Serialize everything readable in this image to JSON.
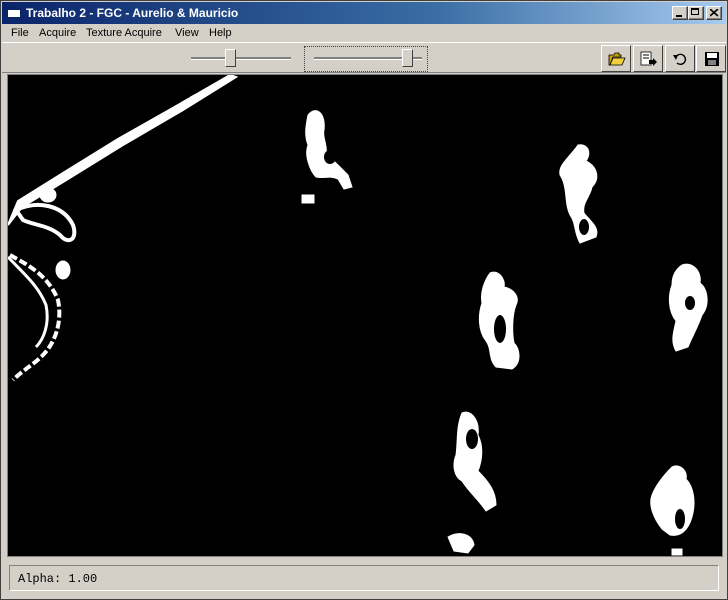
{
  "window": {
    "title": "Trabalho 2 - FGC - Aurelio & Mauricio"
  },
  "menu": {
    "items": [
      {
        "label": "File"
      },
      {
        "label": "Acquire"
      },
      {
        "label": "Texture Acquire"
      },
      {
        "label": "View"
      },
      {
        "label": "Help"
      }
    ]
  },
  "toolbar": {
    "slider1": {
      "value": 0.4
    },
    "slider2": {
      "value": 0.95
    },
    "buttons": [
      {
        "icon": "open-folder-icon"
      },
      {
        "icon": "export-icon"
      },
      {
        "icon": "undo-icon"
      },
      {
        "icon": "save-icon"
      }
    ]
  },
  "status": {
    "text": "Alpha: 1.00"
  }
}
